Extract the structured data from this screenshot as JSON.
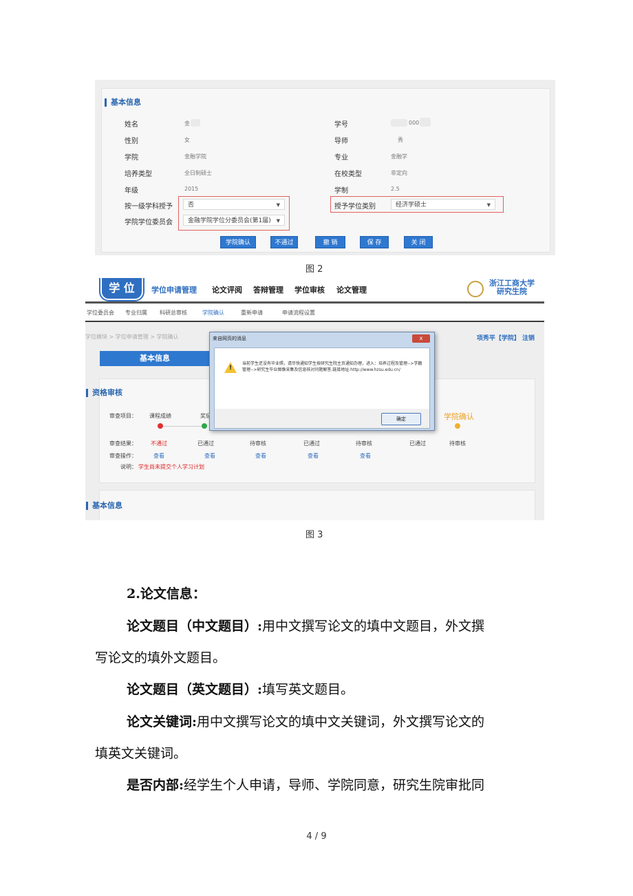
{
  "figure2": {
    "section_title": "基本信息",
    "fields": {
      "name_label": "姓名",
      "name_value": "金",
      "gender_label": "性别",
      "gender_value": "女",
      "college_label": "学院",
      "college_value": "金融学院",
      "type_label": "培养类型",
      "type_value": "全日制硕士",
      "grade_label": "年级",
      "grade_value": "2015",
      "first_level_label": "按一级学科授予",
      "first_level_value": "否",
      "committee_label": "学院学位委员会",
      "committee_value": "金融学院学位分委员会(第1届)",
      "id_label": "学号",
      "id_value": "000",
      "advisor_label": "导师",
      "advisor_value": "秀",
      "major_label": "专业",
      "major_value": "金融学",
      "status_label": "在校类型",
      "status_value": "非定向",
      "years_label": "学制",
      "years_value": "2.5",
      "degree_type_label": "授予学位类别",
      "degree_type_value": "经济学硕士"
    },
    "buttons": {
      "confirm": "学院确认",
      "reject": "不通过",
      "revoke": "撤 销",
      "save": "保 存",
      "close": "关 闭"
    },
    "caption": "图 2"
  },
  "figure3": {
    "logo": "学 位",
    "nav": [
      "学位申请管理",
      "论文评阅",
      "答辩管理",
      "学位审核",
      "论文管理"
    ],
    "university": [
      "浙江工商大学",
      "研究生院"
    ],
    "subnav": [
      "学位委员会",
      "专业归属",
      "科研总审核",
      "学院确认",
      "重新申请",
      "申请流程设置"
    ],
    "breadcrumb": "学位模块 > 学位申请管理 > 学院确认",
    "user": "项秀平【学院】 注销",
    "tab": "基本信息",
    "qual_title": "资格审核",
    "review_item_label": "审查项目：",
    "review_item_1": "课程成绩",
    "review_item_2": "奖惩",
    "last_step": "学院确认",
    "result_label": "审查结果：",
    "results": [
      "不通过",
      "已通过",
      "待审核",
      "已通过",
      "待审核",
      "已通过",
      "待审核"
    ],
    "op_label": "审查操作：",
    "ops": [
      "查看",
      "查看",
      "查看",
      "查看",
      "查看"
    ],
    "note_label": "说明：",
    "note": "学生尚未提交个人学习计划",
    "basic_title": "基本信息",
    "dialog": {
      "title": "来自网页的消息",
      "close": "x",
      "message": "当前学生还没有毕业照，请尽快通知学生按研究生院主页通知办理，进入：培养过程及管理-->学籍管理-->研究生毕业图像采集及信息核对问题解答,链接地址:http://www.hzsu.edu.cn/",
      "ok": "确定"
    },
    "caption": "图 3"
  },
  "body": {
    "heading": "2.论文信息：",
    "p1_bold": "论文题目（中文题目）:",
    "p1_line1": "用中文撰写论文的填中文题目，外文撰",
    "p1_line2": "写论文的填外文题目。",
    "p2_bold": "论文题目（英文题目）:",
    "p2_text": "填写英文题目。",
    "p3_bold": "论文关键词:",
    "p3_line1": "用中文撰写论文的填中文关键词，外文撰写论文的",
    "p3_line2": "填英文关键词。",
    "p4_bold": "是否内部:",
    "p4_text": "经学生个人申请，导师、学院同意，研究生院审批同"
  },
  "page_number": "4 / 9"
}
